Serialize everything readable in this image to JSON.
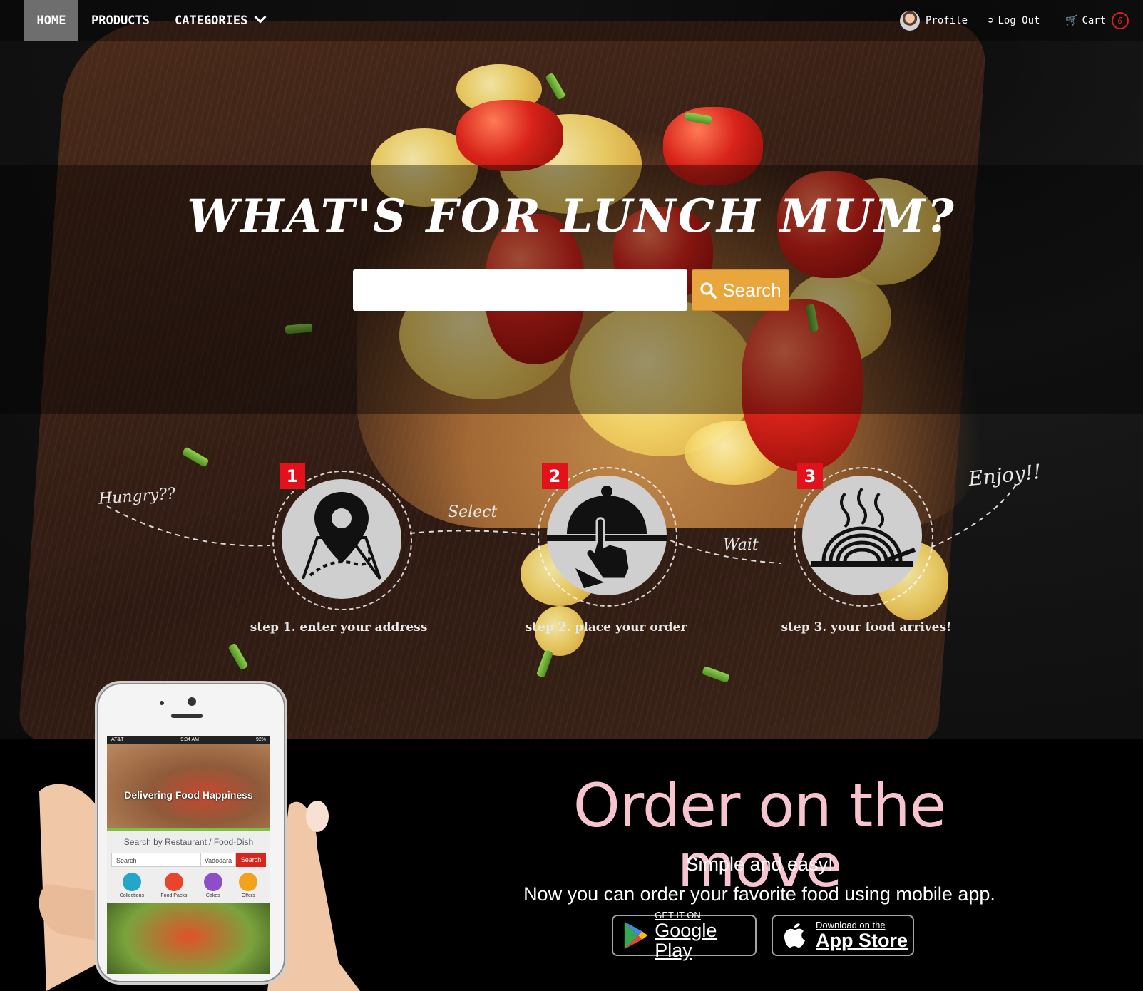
{
  "nav": {
    "home": "HOME",
    "products": "PRODUCTS",
    "categories": "CATEGORIES",
    "profile": "Profile",
    "logout": "Log Out",
    "cart": "Cart",
    "cart_count": "0"
  },
  "hero": {
    "headline": "What's for lunch Mum?",
    "search_placeholder": "",
    "search_button": "Search"
  },
  "steps": {
    "hungry": "Hungry??",
    "select": "Select",
    "wait": "Wait",
    "enjoy": "Enjoy!!",
    "items": [
      {
        "number": "1",
        "label": "step 1. enter your address",
        "icon": "map-pin-icon"
      },
      {
        "number": "2",
        "label": "step 2. place your order",
        "icon": "food-cloche-icon"
      },
      {
        "number": "3",
        "label": "step 3. your food arrives!",
        "icon": "hot-food-bowl-icon"
      }
    ]
  },
  "phone_screen": {
    "carrier": "AT&T",
    "time": "9:34 AM",
    "battery": "92%",
    "banner": "Delivering Food Happiness",
    "search_heading": "Search by Restaurant / Food-Dish",
    "search_placeholder": "Search",
    "city": "Vadodara",
    "search_button": "Search",
    "categories": [
      "Collections",
      "Food Packs",
      "Cakes",
      "Offers"
    ],
    "category_colors": [
      "#22a7c9",
      "#e8452c",
      "#8c4fc9",
      "#f2a21c"
    ]
  },
  "app_section": {
    "title": "Order on the move",
    "subtitle": "Simple and easy!",
    "description": "Now you can order your favorite food using mobile app.",
    "google_small": "GET IT ON",
    "google_big": "Google Play",
    "apple_small": "Download on the",
    "apple_big": "App Store"
  },
  "colors": {
    "accent": "#e8a63c",
    "badge_red": "#e3111b",
    "title_pink": "#f6c3cf"
  }
}
